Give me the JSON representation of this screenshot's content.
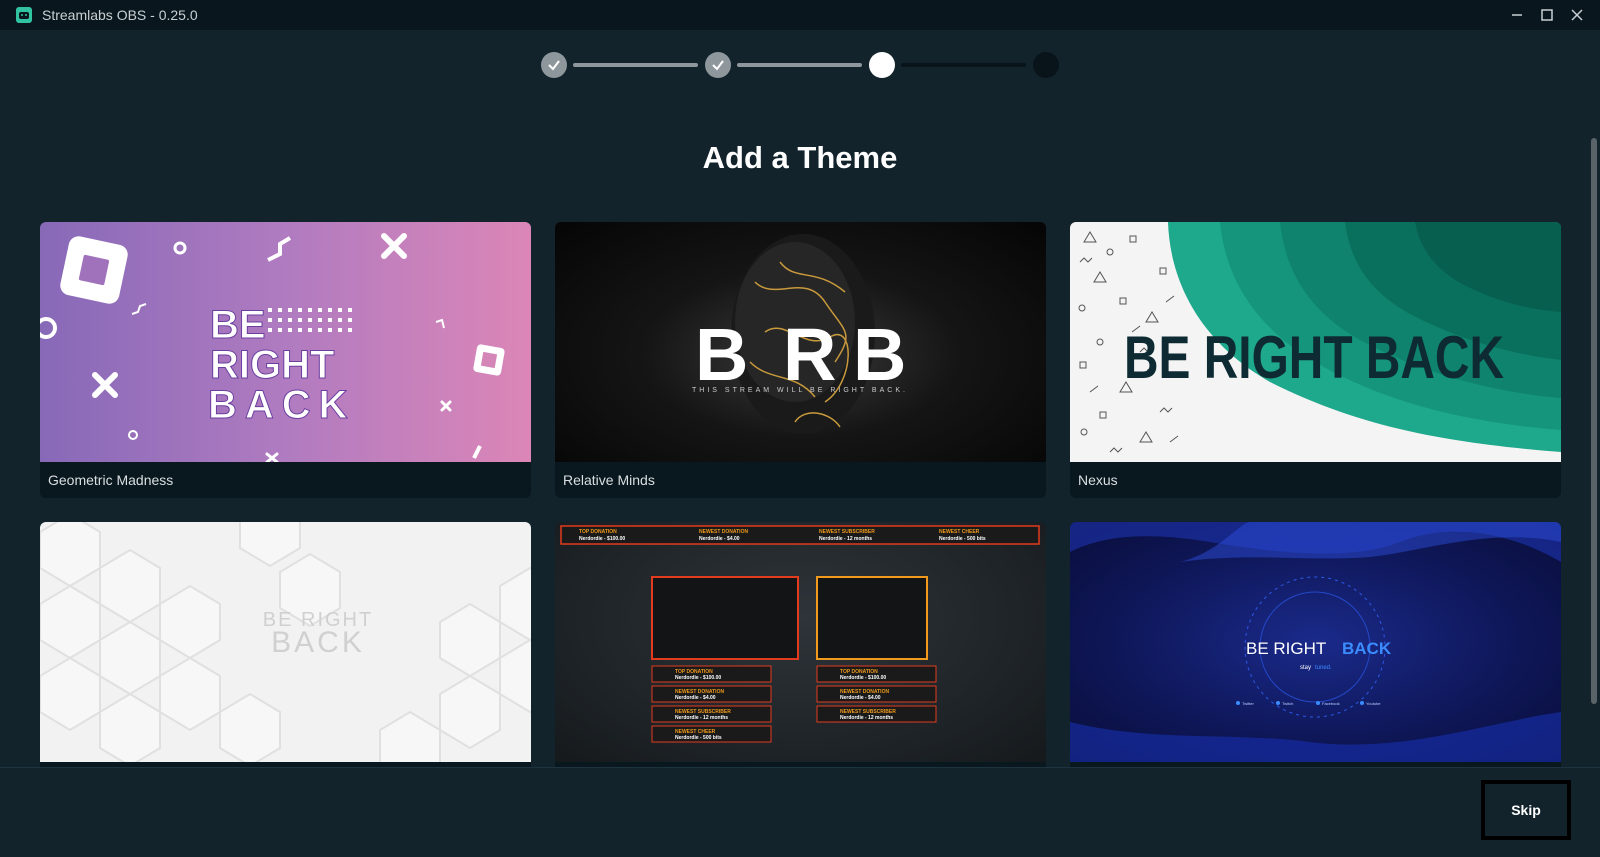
{
  "app": {
    "title": "Streamlabs OBS - 0.25.0",
    "icon": "streamlabs-logo-icon"
  },
  "window_controls": [
    "minimize-icon",
    "maximize-icon",
    "close-icon"
  ],
  "stepper": {
    "total_steps": 4,
    "current_step": 3,
    "completed_steps": 2
  },
  "page": {
    "heading": "Add a Theme"
  },
  "themes": [
    {
      "name": "Geometric Madness",
      "preview_text": "BE:::::::: RIGHT BACK"
    },
    {
      "name": "Relative Minds",
      "preview_text": "BRB",
      "preview_subtext": "THIS STREAM WILL BE RIGHT BACK."
    },
    {
      "name": "Nexus",
      "preview_text": "BE RIGHT BACK"
    },
    {
      "name": "",
      "preview_text": "BE RIGHT BACK"
    },
    {
      "name": "",
      "preview_labels": [
        "TOP DONATION",
        "Nerdordie - $100.00",
        "NEWEST DONATION",
        "Nerdordie - $4.00",
        "NEWEST SUBSCRIBER",
        "Nerdordie - 12 months",
        "NEWEST CHEER",
        "Nerdordie - 500 bits"
      ]
    },
    {
      "name": "",
      "preview_text_a": "BE RIGHT ",
      "preview_text_b": "BACK",
      "preview_subtext_a": "stay ",
      "preview_subtext_b": "tuned.",
      "preview_socials": [
        "Twitter",
        "Twitch",
        "Facebook",
        "Youtube"
      ]
    }
  ],
  "footer": {
    "skip_label": "Skip"
  },
  "colors": {
    "background": "#12232c",
    "titlebar": "#09161d",
    "accent": "#31c3a2",
    "card_footer": "#09171e"
  }
}
